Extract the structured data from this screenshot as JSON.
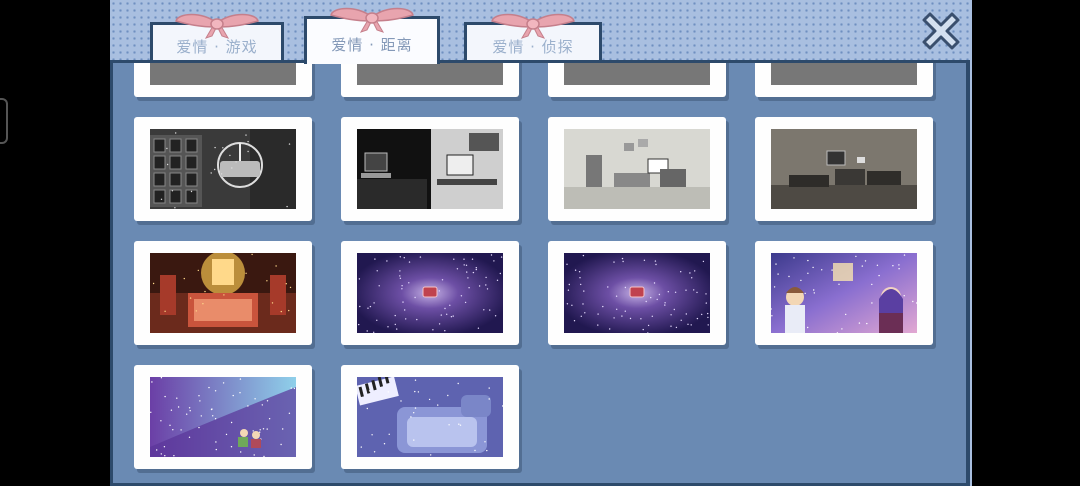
{
  "tabs": [
    {
      "label": "爱情 · 游戏",
      "active": false
    },
    {
      "label": "爱情 · 距离",
      "active": true
    },
    {
      "label": "爱情 · 侦探",
      "active": false
    }
  ],
  "close_icon": "close-x-icon",
  "gallery": {
    "columns": 4,
    "items": [
      {
        "name": "cg-partial-1",
        "scene": "partial"
      },
      {
        "name": "cg-partial-2",
        "scene": "partial"
      },
      {
        "name": "cg-partial-3",
        "scene": "partial"
      },
      {
        "name": "cg-partial-4",
        "scene": "partial"
      },
      {
        "name": "cg-ferris-wheel-night",
        "scene": "gray"
      },
      {
        "name": "cg-two-desks-computers",
        "scene": "dark-desks"
      },
      {
        "name": "cg-gray-bedroom",
        "scene": "gray-room"
      },
      {
        "name": "cg-dim-bedroom",
        "scene": "dim-room"
      },
      {
        "name": "cg-golden-bed-chamber",
        "scene": "gold"
      },
      {
        "name": "cg-cosmos-piano",
        "scene": "cosmos"
      },
      {
        "name": "cg-cosmos-radio",
        "scene": "cosmos"
      },
      {
        "name": "cg-couple-galaxy",
        "scene": "galaxy"
      },
      {
        "name": "cg-couple-stardust",
        "scene": "stardust"
      },
      {
        "name": "cg-piano-sofa-room",
        "scene": "piano-room"
      }
    ]
  },
  "colors": {
    "background_dots": "#a9bfe0",
    "panel": "#6a8ab3",
    "border": "#2d4a6b",
    "bow": "#e8a4ae",
    "tab_text": "#9bb0cc"
  }
}
